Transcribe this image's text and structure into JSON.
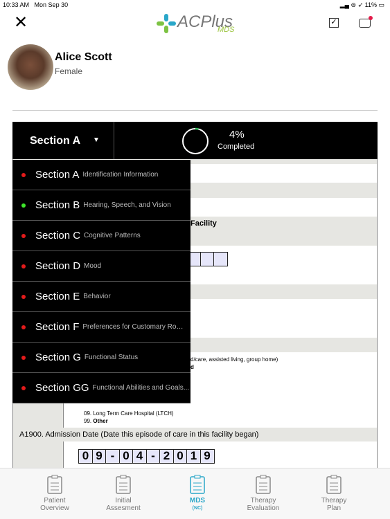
{
  "status_bar": {
    "time": "10:33 AM",
    "date": "Mon Sep 30",
    "battery": "11%"
  },
  "header": {
    "logo_text": "ACPlus",
    "logo_sub": "MDS",
    "logo_tm": "™"
  },
  "patient": {
    "name": "Alice  Scott",
    "gender": "Female"
  },
  "section_bar": {
    "selected": "Section A",
    "progress_percent": 4,
    "progress_label": "4%",
    "completed_label": "Completed"
  },
  "colors": {
    "incomplete": "#e31b1b",
    "complete": "#3ee62a",
    "accent": "#2aa7c9",
    "progress": "#2fbf5a"
  },
  "sections": [
    {
      "name": "Section A",
      "desc": "Identification Information",
      "status": "incomplete"
    },
    {
      "name": "Section B",
      "desc": "Hearing, Speech, and Vision",
      "status": "complete"
    },
    {
      "name": "Section C",
      "desc": "Cognitive Patterns",
      "status": "incomplete"
    },
    {
      "name": "Section D",
      "desc": "Mood",
      "status": "incomplete"
    },
    {
      "name": "Section E",
      "desc": "Behavior",
      "status": "incomplete"
    },
    {
      "name": "Section F",
      "desc": "Preferences for Customary Routi...",
      "status": "incomplete"
    },
    {
      "name": "Section G",
      "desc": "Functional Status",
      "status": "incomplete"
    },
    {
      "name": "Section GG",
      "desc": "Functional Abilities and Goals...",
      "status": "incomplete"
    }
  ],
  "form": {
    "facility_fragment": "Facility",
    "option_fragment1": "d/care, assisted living, group home)",
    "option_fragment2": "d",
    "option_09": "09. Long Term Care Hospital (LTCH)",
    "option_99_num": "99.",
    "option_99": "Other",
    "a1900_title": "A1900. Admission Date (Date this episode of care in this facility began)",
    "admission_date_chars": [
      "0",
      "9",
      "-",
      "0",
      "4",
      "-",
      "2",
      "0",
      "1",
      "9"
    ]
  },
  "tabs": [
    {
      "label1": "Patient",
      "label2": "Overview",
      "icon": "clipboard-pulse-icon"
    },
    {
      "label1": "Initial",
      "label2": "Assesment",
      "icon": "clipboard-pen-icon"
    },
    {
      "label1": "MDS",
      "label2": "(NC)",
      "icon": "clipboard-list-icon",
      "active": true
    },
    {
      "label1": "Therapy",
      "label2": "Evaluation",
      "icon": "clipboard-check-icon"
    },
    {
      "label1": "Therapy",
      "label2": "Plan",
      "icon": "clipboard-heart-icon"
    }
  ]
}
